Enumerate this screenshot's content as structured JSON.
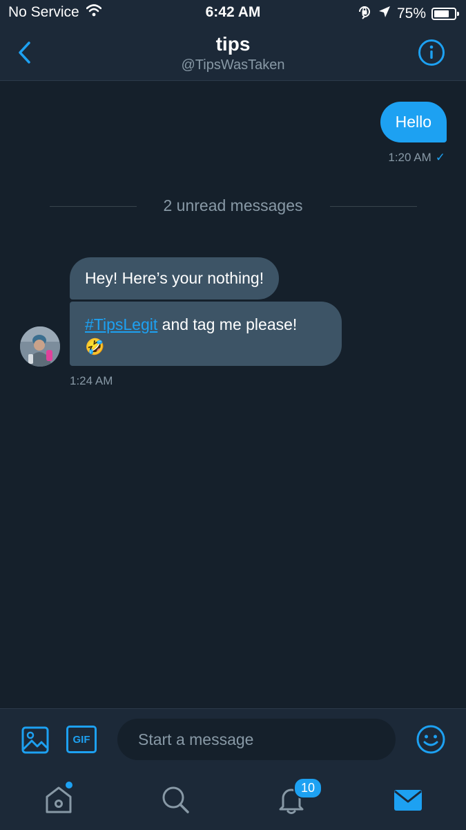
{
  "status_bar": {
    "carrier": "No Service",
    "time": "6:42 AM",
    "battery_percent": "75%",
    "battery_level": 0.75,
    "icons": [
      "wifi-icon",
      "orientation-lock-icon",
      "location-arrow-icon",
      "battery-icon"
    ]
  },
  "header": {
    "title": "tips",
    "handle": "@TipsWasTaken",
    "back_icon": "chevron-left-icon",
    "info_icon": "info-icon"
  },
  "conversation": {
    "outgoing": {
      "text": "Hello",
      "timestamp": "1:20 AM",
      "status": "✓"
    },
    "unread_divider": "2 unread messages",
    "incoming": {
      "messages": [
        {
          "text": "Hey! Here’s your nothing!"
        },
        {
          "hashtag": "#TipsLegit",
          "text": " and tag me please!",
          "emoji": "🤣"
        }
      ],
      "timestamp": "1:24 AM"
    }
  },
  "composer": {
    "placeholder": "Start a message",
    "gif_label": "GIF",
    "icons": [
      "image-icon",
      "gif-icon",
      "emoji-icon"
    ]
  },
  "tab_bar": {
    "tabs": [
      "home",
      "search",
      "notifications",
      "messages"
    ],
    "notifications_badge": "10"
  },
  "colors": {
    "background": "#15202b",
    "bar": "#1c2938",
    "accent": "#1da1f2",
    "incoming_bubble": "#3d5466",
    "secondary_text": "#8899a6"
  }
}
